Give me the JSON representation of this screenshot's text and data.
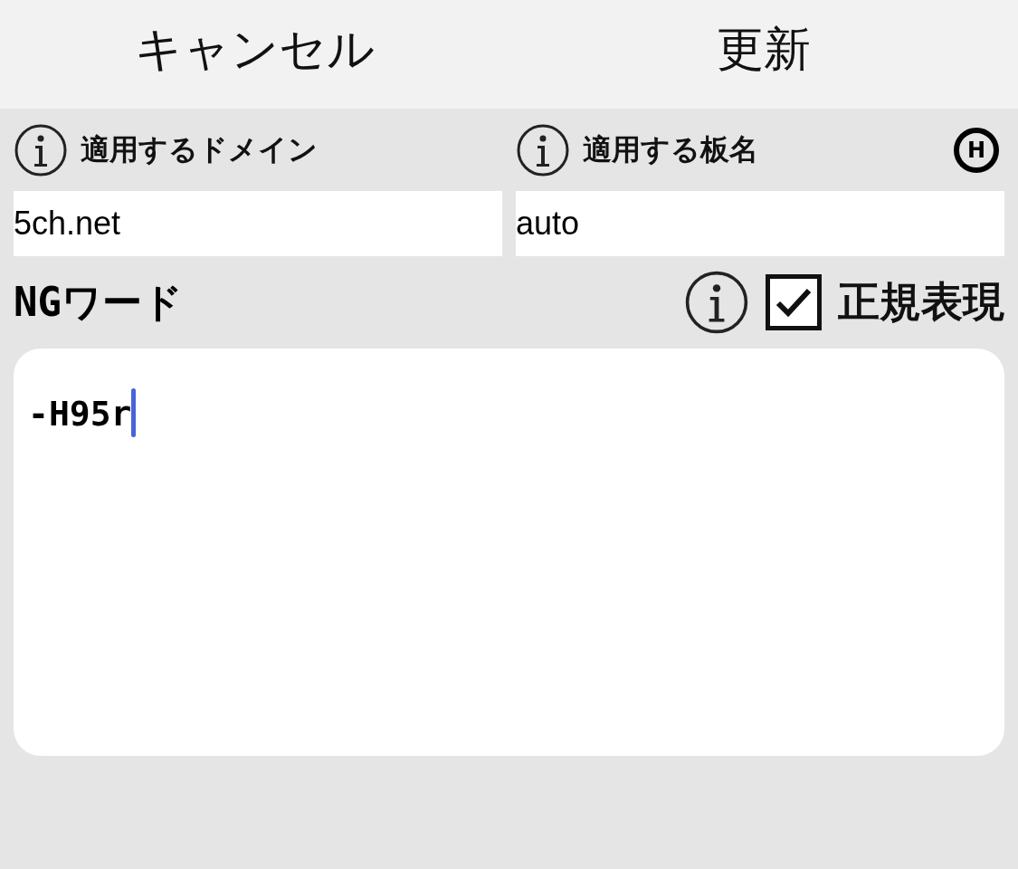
{
  "toolbar": {
    "cancel": "キャンセル",
    "update": "更新"
  },
  "domain": {
    "label": "適用するドメイン",
    "value": "5ch.net"
  },
  "board": {
    "label": "適用する板名",
    "value": "auto",
    "badge": "H"
  },
  "ng_word": {
    "label": "NGワード",
    "regex": {
      "label": "正規表現",
      "checked": true
    },
    "value": "-H95r"
  }
}
